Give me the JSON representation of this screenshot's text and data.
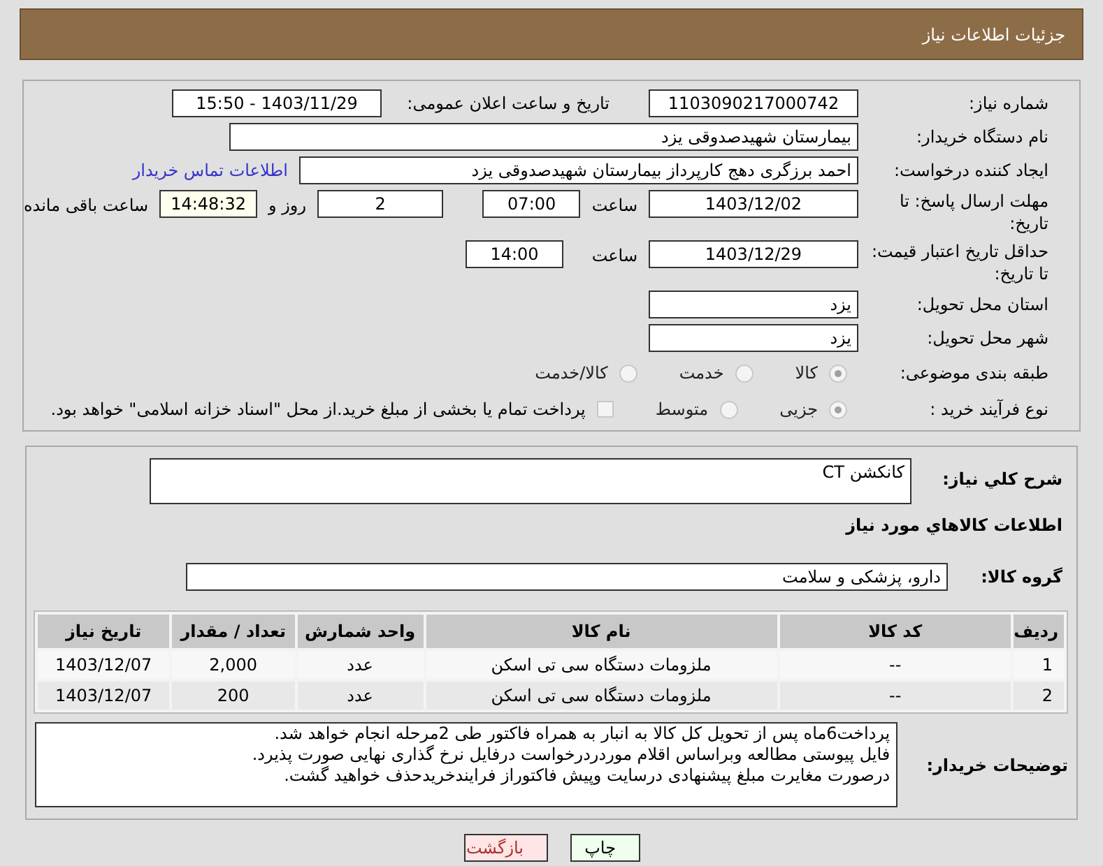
{
  "header": {
    "title": "جزئیات اطلاعات نیاز"
  },
  "need_number": {
    "label": "شماره نیاز:",
    "value": "1103090217000742"
  },
  "announce": {
    "label": "تاریخ و ساعت اعلان عمومی:",
    "value": "1403/11/29 - 15:50"
  },
  "buyer": {
    "label": "نام دستگاه خریدار:",
    "value": "بیمارستان شهیدصدوقی یزد"
  },
  "requester": {
    "label": "ایجاد کننده درخواست:",
    "value": "احمد برزگری دهج کارپرداز بیمارستان شهیدصدوقی یزد",
    "link": "اطلاعات تماس خریدار"
  },
  "deadline": {
    "label": "مهلت ارسال پاسخ: تا تاریخ:",
    "date": "1403/12/02",
    "time_label": "ساعت",
    "time": "07:00",
    "days": "2",
    "days_label": "روز و",
    "remaining": "14:48:32",
    "remaining_label": "ساعت باقی مانده"
  },
  "validity": {
    "label": "حداقل تاریخ اعتبار قیمت: تا تاریخ:",
    "date": "1403/12/29",
    "time_label": "ساعت",
    "time": "14:00"
  },
  "province": {
    "label": "استان محل تحویل:",
    "value": "یزد"
  },
  "city": {
    "label": "شهر محل تحویل:",
    "value": "یزد"
  },
  "category": {
    "label": "طبقه بندی موضوعی:",
    "options": [
      {
        "label": "کالا",
        "selected": true
      },
      {
        "label": "خدمت",
        "selected": false
      },
      {
        "label": "کالا/خدمت",
        "selected": false
      }
    ]
  },
  "purchase_type": {
    "label": "نوع فرآیند خرید :",
    "options": [
      {
        "label": "جزیی",
        "selected": true
      },
      {
        "label": "متوسط",
        "selected": false
      }
    ],
    "treasury": {
      "label": "پرداخت تمام یا بخشی از مبلغ خرید.از محل \"اسناد خزانه اسلامی\" خواهد بود.",
      "checked": false
    }
  },
  "summary": {
    "label": "شرح کلي نياز:",
    "value": "کانکشن CT"
  },
  "goods_heading": "اطلاعات کالاهاي مورد نياز",
  "goods_group": {
    "label": "گروه کالا:",
    "value": "دارو، پزشکی و سلامت"
  },
  "table": {
    "columns": [
      "ردیف",
      "کد کالا",
      "نام کالا",
      "واحد شمارش",
      "تعداد / مقدار",
      "تاریخ نیاز"
    ],
    "rows": [
      [
        "1",
        "--",
        "ملزومات دستگاه سی تی اسکن",
        "عدد",
        "2,000",
        "1403/12/07"
      ],
      [
        "2",
        "--",
        "ملزومات دستگاه سی تی اسکن",
        "عدد",
        "200",
        "1403/12/07"
      ]
    ]
  },
  "buyer_notes": {
    "label": "توضیحات خریدار:",
    "lines": [
      "پرداخت6ماه پس از تحویل کل کالا به انبار به همراه فاکتور طی 2مرحله انجام خواهد شد.",
      "فایل پیوستی مطالعه وبراساس اقلام موردردرخواست درفایل نرخ گذاری نهایی  صورت پذیرد.",
      "درصورت مغایرت مبلغ پیشنهادی درسایت وپیش فاکتوراز فرایندخریدحذف خواهید گشت."
    ]
  },
  "buttons": [
    {
      "label": "چاپ",
      "kind": "print"
    },
    {
      "label": "بازگشت",
      "kind": "back"
    }
  ]
}
